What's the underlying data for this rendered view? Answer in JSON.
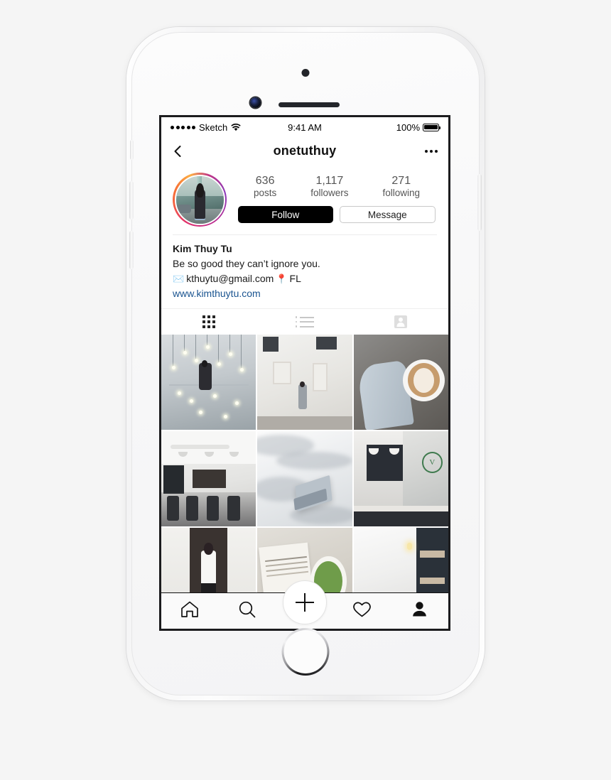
{
  "device": {
    "name": "iPhone 6s white mockup",
    "camera_icon": "front-camera",
    "speaker_icon": "earpiece-speaker",
    "home_button_icon": "home-button"
  },
  "status_bar": {
    "signal_icon": "signal-dots",
    "carrier": "Sketch",
    "wifi_icon": "wifi-icon",
    "time": "9:41 AM",
    "battery_percent": "100%",
    "battery_icon": "battery-full-icon"
  },
  "nav_header": {
    "back_icon": "chevron-left-icon",
    "title": "onetuthuy",
    "more_icon": "ellipsis-icon"
  },
  "profile": {
    "avatar_alt": "profile-photo",
    "stats": [
      {
        "number": "636",
        "label": "posts"
      },
      {
        "number": "1,117",
        "label": "followers"
      },
      {
        "number": "271",
        "label": "following"
      }
    ],
    "follow_label": "Follow",
    "message_label": "Message",
    "bio": {
      "name": "Kim Thuy Tu",
      "tagline": "Be so good they can’t ignore you.",
      "email_emoji": "✉️",
      "email": "kthuytu@gmail.com",
      "location_emoji": "📍",
      "location": "FL",
      "website": "www.kimthuytu.com",
      "website_color": "#1a5490"
    }
  },
  "content_tabs": [
    {
      "name": "grid-tab",
      "icon": "grid-icon",
      "active": true
    },
    {
      "name": "list-tab",
      "icon": "list-icon",
      "active": false
    },
    {
      "name": "tagged-tab",
      "icon": "person-square-icon",
      "active": false
    }
  ],
  "photo_grid": [
    {
      "id": 1,
      "alt": "woman on balcony under hanging light bulbs"
    },
    {
      "id": 2,
      "alt": "woman in front of white brick wall"
    },
    {
      "id": 3,
      "alt": "hand holding latte art coffee cup"
    },
    {
      "id": 4,
      "alt": "bright minimal cafe interior with chairs"
    },
    {
      "id": 5,
      "alt": "laptop on white rumpled bedsheets"
    },
    {
      "id": 6,
      "alt": "coffee shop counter with menu board"
    },
    {
      "id": 7,
      "alt": "woman standing by dark doorway"
    },
    {
      "id": 8,
      "alt": "newspaper and matcha latte flat lay"
    },
    {
      "id": 9,
      "alt": "white gallery interior with shelves"
    }
  ],
  "bottom_nav": [
    {
      "name": "home-tab",
      "icon": "home-icon",
      "active": false
    },
    {
      "name": "search-tab",
      "icon": "search-icon",
      "active": false
    },
    {
      "name": "add-post-button",
      "icon": "plus-icon",
      "active": false
    },
    {
      "name": "activity-tab",
      "icon": "heart-icon",
      "active": false
    },
    {
      "name": "profile-tab",
      "icon": "person-filled-icon",
      "active": true
    }
  ],
  "colors": {
    "accent_link": "#1a5490",
    "follow_bg": "#000000",
    "page_bg": "#f5f5f5",
    "screen_bg": "#ffffff",
    "gradient_ring": "#c13584"
  }
}
